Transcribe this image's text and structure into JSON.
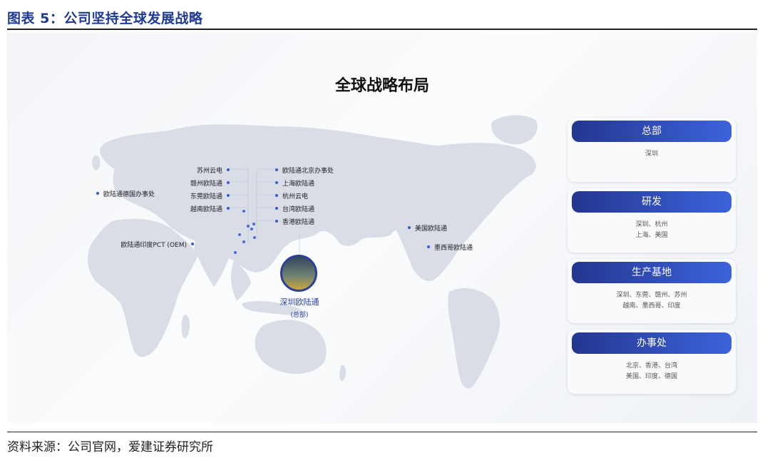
{
  "figure_title": "图表 5：公司坚持全球发展战略",
  "diagram_title": "全球战略布局",
  "china_left": [
    "苏州云电",
    "赣州欧陆通",
    "东莞欧陆通",
    "越南欧陆通"
  ],
  "china_right": [
    "欧陆通北京办事处",
    "上海欧陆通",
    "杭州云电",
    "台湾欧陆通",
    "香港欧陆通"
  ],
  "germany": "欧陆通德国办事处",
  "india": "欧陆通印度PCT (OEM)",
  "usa": "美国欧陆通",
  "mexico": "墨西哥欧陆通",
  "hq": {
    "name": "深圳欧陆通",
    "note": "(总部)"
  },
  "cards": [
    {
      "title": "总部",
      "lines": [
        "深圳"
      ]
    },
    {
      "title": "研发",
      "lines": [
        "深圳、杭州",
        "上海、美国"
      ]
    },
    {
      "title": "生产基地",
      "lines": [
        "深圳、东莞、赣州、苏州",
        "越南、墨西哥、印度"
      ]
    },
    {
      "title": "办事处",
      "lines": [
        "北京、香港、台湾",
        "美国、印度、德国"
      ]
    }
  ],
  "source": "资料来源：公司官网，爱建证券研究所",
  "colors": {
    "title": "#1f3a93",
    "card_header_start": "#24368f",
    "card_header_end": "#3c63dc",
    "map": "#d7dce5"
  }
}
